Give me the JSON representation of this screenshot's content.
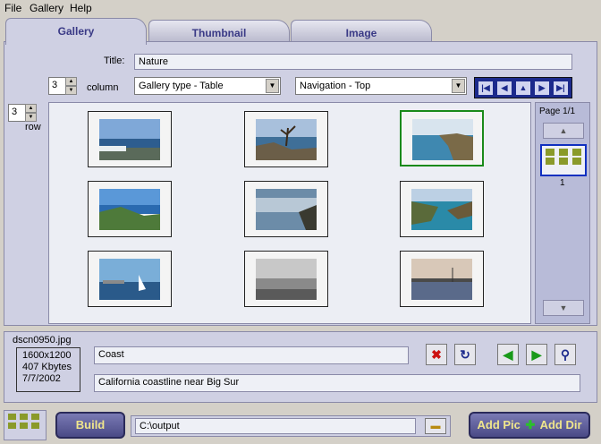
{
  "menu": [
    {
      "label": "File"
    },
    {
      "label": "Gallery"
    },
    {
      "label": "Help"
    }
  ],
  "tabs": [
    {
      "label": "Gallery",
      "active": true
    },
    {
      "label": "Thumbnail",
      "active": false
    },
    {
      "label": "Image",
      "active": false
    }
  ],
  "gallery": {
    "title_label": "Title:",
    "title_value": "Nature",
    "columns_value": "3",
    "columns_label": "column",
    "rows_value": "3",
    "rows_label": "row",
    "gallery_type": "Gallery type - Table",
    "navigation": "Navigation - Top",
    "nav_icons": [
      "first-icon",
      "prev-icon",
      "up-icon",
      "next-icon",
      "last-icon"
    ]
  },
  "thumbnails": [
    {
      "scene": "sea-horizon"
    },
    {
      "scene": "rocky-cypress"
    },
    {
      "scene": "coastline-cliffs",
      "selected": true
    },
    {
      "scene": "bay-hills"
    },
    {
      "scene": "sun-on-water"
    },
    {
      "scene": "cove-beach"
    },
    {
      "scene": "sailboat-city"
    },
    {
      "scene": "misty-shore"
    },
    {
      "scene": "harbor-sunset"
    }
  ],
  "pager": {
    "page_label": "Page 1/1",
    "page_number": "1"
  },
  "image_info": {
    "filename": "dscn0950.jpg",
    "dimensions": "1600x1200",
    "size": "407 Kbytes",
    "date": "7/7/2002",
    "caption": "Coast",
    "description": "California coastline near Big Sur"
  },
  "bottom": {
    "build_label": "Build",
    "output_path": "C:\\output",
    "add_label": "Add Pic",
    "add_dir_label": "Add Dir"
  },
  "colors": {
    "panel": "#cfd0e3",
    "accent": "#1c2a8c",
    "selected_border": "#1a8a1a",
    "button_text": "#f0e68c"
  }
}
